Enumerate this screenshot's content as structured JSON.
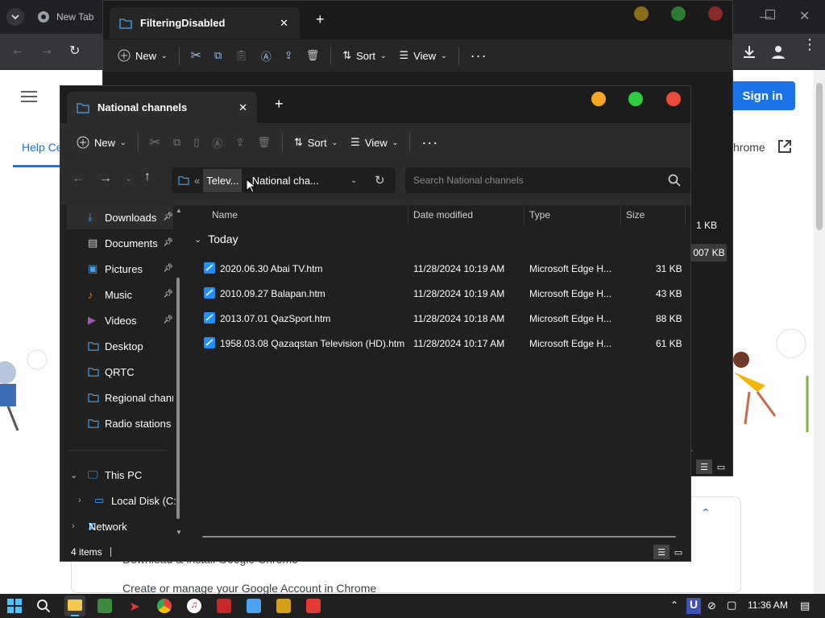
{
  "chrome": {
    "tab_title": "New Tab",
    "sign_in": "Sign in",
    "help_center": "Help Ce",
    "link_label": "hrome",
    "size_1": "1 KB",
    "size_2": "007 KB",
    "page_line_1": "Download & install Google Chrome",
    "page_line_2": "Create or manage your Google Account in Chrome"
  },
  "back_window": {
    "tab_title": "FilteringDisabled",
    "new_label": "New",
    "sort_label": "Sort",
    "view_label": "View"
  },
  "explorer": {
    "tab_title": "National channels",
    "new_label": "New",
    "sort_label": "Sort",
    "view_label": "View",
    "breadcrumb": {
      "overflow": "«",
      "parent": "Telev...",
      "current": "National cha..."
    },
    "search_placeholder": "Search National channels",
    "sidebar": {
      "items": [
        {
          "label": "Downloads",
          "pinned": true
        },
        {
          "label": "Documents",
          "pinned": true
        },
        {
          "label": "Pictures",
          "pinned": true
        },
        {
          "label": "Music",
          "pinned": true
        },
        {
          "label": "Videos",
          "pinned": true
        },
        {
          "label": "Desktop",
          "pinned": false
        },
        {
          "label": "QRTC",
          "pinned": false
        },
        {
          "label": "Regional channe",
          "pinned": false
        },
        {
          "label": "Radio stations",
          "pinned": false
        }
      ],
      "this_pc": "This PC",
      "local_disk": "Local Disk (C:)",
      "network": "Network"
    },
    "columns": {
      "name": "Name",
      "date": "Date modified",
      "type": "Type",
      "size": "Size"
    },
    "group_label": "Today",
    "files": [
      {
        "name": "2020.06.30 Abai TV.htm",
        "date": "11/28/2024 10:19 AM",
        "type": "Microsoft Edge H...",
        "size": "31 KB"
      },
      {
        "name": "2010.09.27 Balapan.htm",
        "date": "11/28/2024 10:19 AM",
        "type": "Microsoft Edge H...",
        "size": "43 KB"
      },
      {
        "name": "2013.07.01 QazSport.htm",
        "date": "11/28/2024 10:18 AM",
        "type": "Microsoft Edge H...",
        "size": "88 KB"
      },
      {
        "name": "1958.03.08 Qazaqstan Television (HD).htm",
        "date": "11/28/2024 10:17 AM",
        "type": "Microsoft Edge H...",
        "size": "61 KB"
      }
    ],
    "status": "4 items"
  },
  "taskbar": {
    "time": "11:36 AM"
  },
  "colors": {
    "accent_blue": "#1a73e8",
    "folder_blue": "#4aa3f0",
    "dot_yellow": "#f5a623",
    "dot_green": "#2ecc40",
    "dot_red": "#e74c3c"
  }
}
